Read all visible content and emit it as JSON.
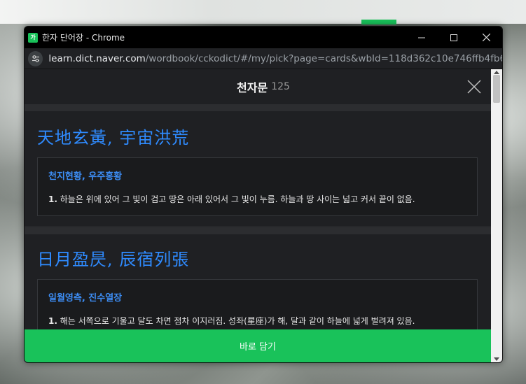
{
  "window": {
    "title": "한자 단어장 - Chrome",
    "app_icon_glyph": "가",
    "url_host": "learn.dict.naver.com",
    "url_path": "/wordbook/cckodict/#/my/pick?page=cards&wbId=118d362c10e746ffb4fb6..."
  },
  "page": {
    "title": "천자문",
    "count": "125"
  },
  "entries": [
    {
      "hanja": "天地玄黃, 宇宙洪荒",
      "reading": "천지현황, 우주홍황",
      "def_num": "1.",
      "definition": "하늘은 위에 있어 그 빛이 검고 땅은 아래 있어서 그 빛이 누름. 하늘과 땅 사이는 넓고 커서 끝이 없음."
    },
    {
      "hanja": "日月盈昃, 辰宿列張",
      "reading": "일월영측, 진수열장",
      "def_num": "1.",
      "definition": "해는 서쪽으로 기울고 달도 차면 점차 이지러짐. 성좌(星座)가 해, 달과 같이 하늘에 넓게 벌려져 있음."
    }
  ],
  "actions": {
    "save_label": "바로 담기"
  },
  "colors": {
    "accent_green": "#19c25a",
    "hanja_blue": "#2f8bff"
  }
}
